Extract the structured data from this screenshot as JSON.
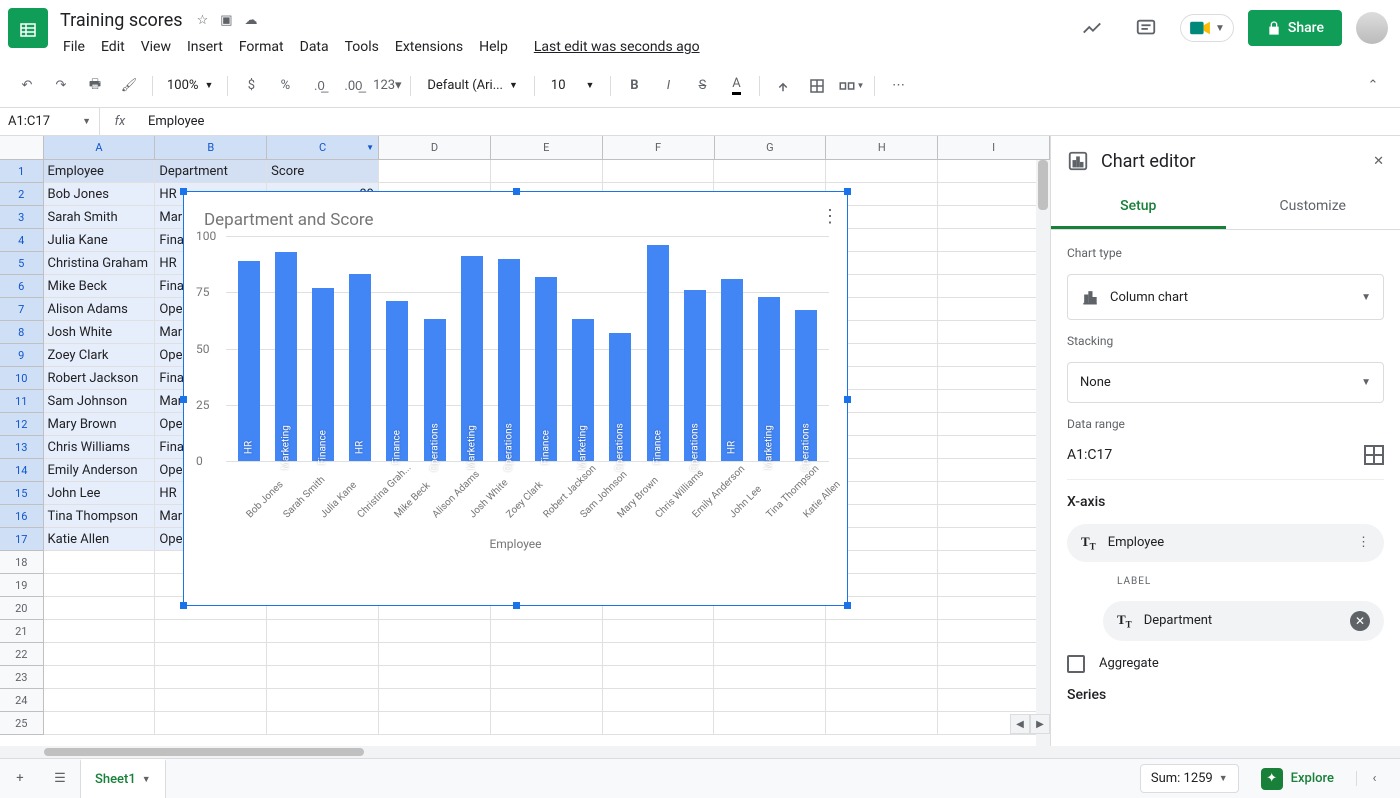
{
  "doc": {
    "title": "Training scores",
    "last_edit": "Last edit was seconds ago"
  },
  "menu": [
    "File",
    "Edit",
    "View",
    "Insert",
    "Format",
    "Data",
    "Tools",
    "Extensions",
    "Help"
  ],
  "toolbar": {
    "zoom": "100%",
    "font": "Default (Ari...",
    "size": "10"
  },
  "share": "Share",
  "namebox": "A1:C17",
  "fx_value": "Employee",
  "columns": [
    "A",
    "B",
    "C",
    "D",
    "E",
    "F",
    "G",
    "H",
    "I"
  ],
  "headers": [
    "Employee",
    "Department",
    "Score"
  ],
  "rows": [
    {
      "employee": "Bob Jones",
      "department": "HR",
      "score": 89
    },
    {
      "employee": "Sarah Smith",
      "department": "Marketing",
      "score": 93
    },
    {
      "employee": "Julia Kane",
      "department": "Finance",
      "score": 77
    },
    {
      "employee": "Christina Graham",
      "department": "HR",
      "score": 83
    },
    {
      "employee": "Mike Beck",
      "department": "Finance",
      "score": 71
    },
    {
      "employee": "Alison Adams",
      "department": "Operations",
      "score": 63
    },
    {
      "employee": "Josh White",
      "department": "Marketing",
      "score": 91
    },
    {
      "employee": "Zoey Clark",
      "department": "Operations",
      "score": 90
    },
    {
      "employee": "Robert Jackson",
      "department": "Finance",
      "score": 82
    },
    {
      "employee": "Sam Johnson",
      "department": "Marketing",
      "score": 63
    },
    {
      "employee": "Mary Brown",
      "department": "Operations",
      "score": 57
    },
    {
      "employee": "Chris Williams",
      "department": "Finance",
      "score": 96
    },
    {
      "employee": "Emily Anderson",
      "department": "Operations",
      "score": 76
    },
    {
      "employee": "John Lee",
      "department": "HR",
      "score": 81
    },
    {
      "employee": "Tina Thompson",
      "department": "Marketing",
      "score": 73
    },
    {
      "employee": "Katie Allen",
      "department": "Operations",
      "score": 67
    }
  ],
  "chart_editor": {
    "title": "Chart editor",
    "tab_setup": "Setup",
    "tab_customize": "Customize",
    "chart_type_label": "Chart type",
    "chart_type_value": "Column chart",
    "stacking_label": "Stacking",
    "stacking_value": "None",
    "data_range_label": "Data range",
    "data_range_value": "A1:C17",
    "xaxis_label": "X-axis",
    "xaxis_value": "Employee",
    "label_heading": "LABEL",
    "label_value": "Department",
    "aggregate": "Aggregate",
    "series_label": "Series"
  },
  "sheet": {
    "name": "Sheet1",
    "sum": "Sum: 1259",
    "explore": "Explore"
  },
  "chart_data": {
    "type": "bar",
    "title": "Department  and Score",
    "xlabel": "Employee",
    "ylabel": "",
    "ylim": [
      0,
      100
    ],
    "yticks": [
      0,
      25,
      50,
      75,
      100
    ],
    "categories": [
      "Bob Jones",
      "Sarah Smith",
      "Julia Kane",
      "Christina Grah...",
      "Mike Beck",
      "Alison Adams",
      "Josh White",
      "Zoey Clark",
      "Robert Jackson",
      "Sam Johnson",
      "Mary Brown",
      "Chris Williams",
      "Emily Anderson",
      "John Lee",
      "Tina Thompson",
      "Katie Allen"
    ],
    "values": [
      89,
      93,
      77,
      83,
      71,
      63,
      91,
      90,
      82,
      63,
      57,
      96,
      76,
      81,
      73,
      67
    ],
    "bar_labels": [
      "HR",
      "Marketing",
      "Finance",
      "HR",
      "Finance",
      "Operations",
      "Marketing",
      "Operations",
      "Finance",
      "Marketing",
      "Operations",
      "Finance",
      "Operations",
      "HR",
      "Marketing",
      "Operations"
    ]
  }
}
